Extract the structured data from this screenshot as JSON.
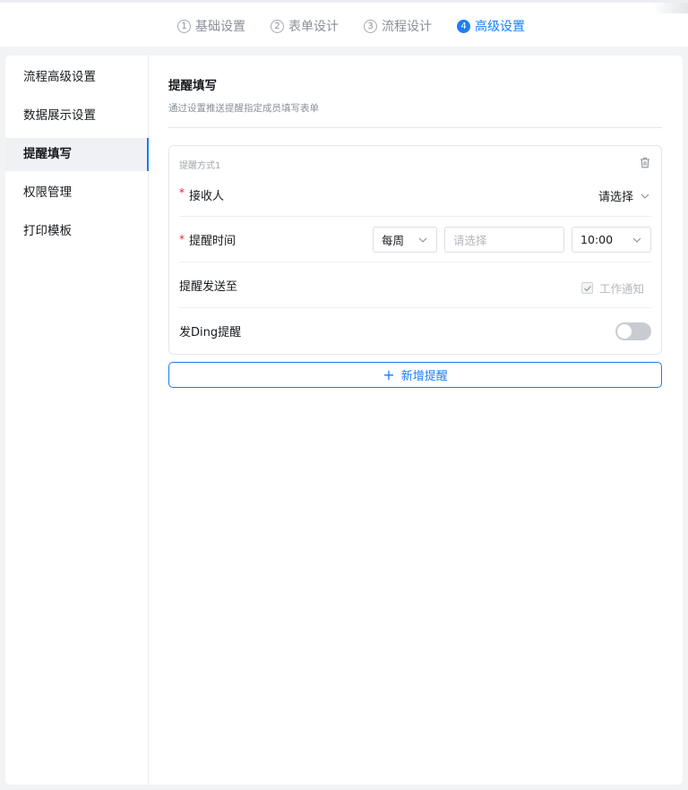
{
  "steps": [
    {
      "num": "1",
      "label": "基础设置"
    },
    {
      "num": "2",
      "label": "表单设计"
    },
    {
      "num": "3",
      "label": "流程设计"
    },
    {
      "num": "4",
      "label": "高级设置"
    }
  ],
  "active_step": 3,
  "sidebar": {
    "items": [
      {
        "label": "流程高级设置"
      },
      {
        "label": "数据展示设置"
      },
      {
        "label": "提醒填写"
      },
      {
        "label": "权限管理"
      },
      {
        "label": "打印模板"
      }
    ],
    "active_index": 2
  },
  "section": {
    "title": "提醒填写",
    "description": "通过设置推送提醒指定成员填写表单"
  },
  "remind": {
    "label": "提醒方式1",
    "trash_icon": "trash-icon",
    "receiver": {
      "required_mark": "*",
      "label": "接收人",
      "value": "请选择"
    },
    "time": {
      "required_mark": "*",
      "label": "提醒时间",
      "frequency": "每周",
      "day_placeholder": "请选择",
      "clock": "10:00"
    },
    "send_to": {
      "label": "提醒发送至",
      "option": "工作通知",
      "checked": true
    },
    "ding": {
      "label": "发Ding提醒",
      "enabled": false
    }
  },
  "add_button": {
    "icon": "+",
    "label": "新增提醒"
  },
  "colors": {
    "accent": "#1a7ef5",
    "required": "#e0252e"
  }
}
